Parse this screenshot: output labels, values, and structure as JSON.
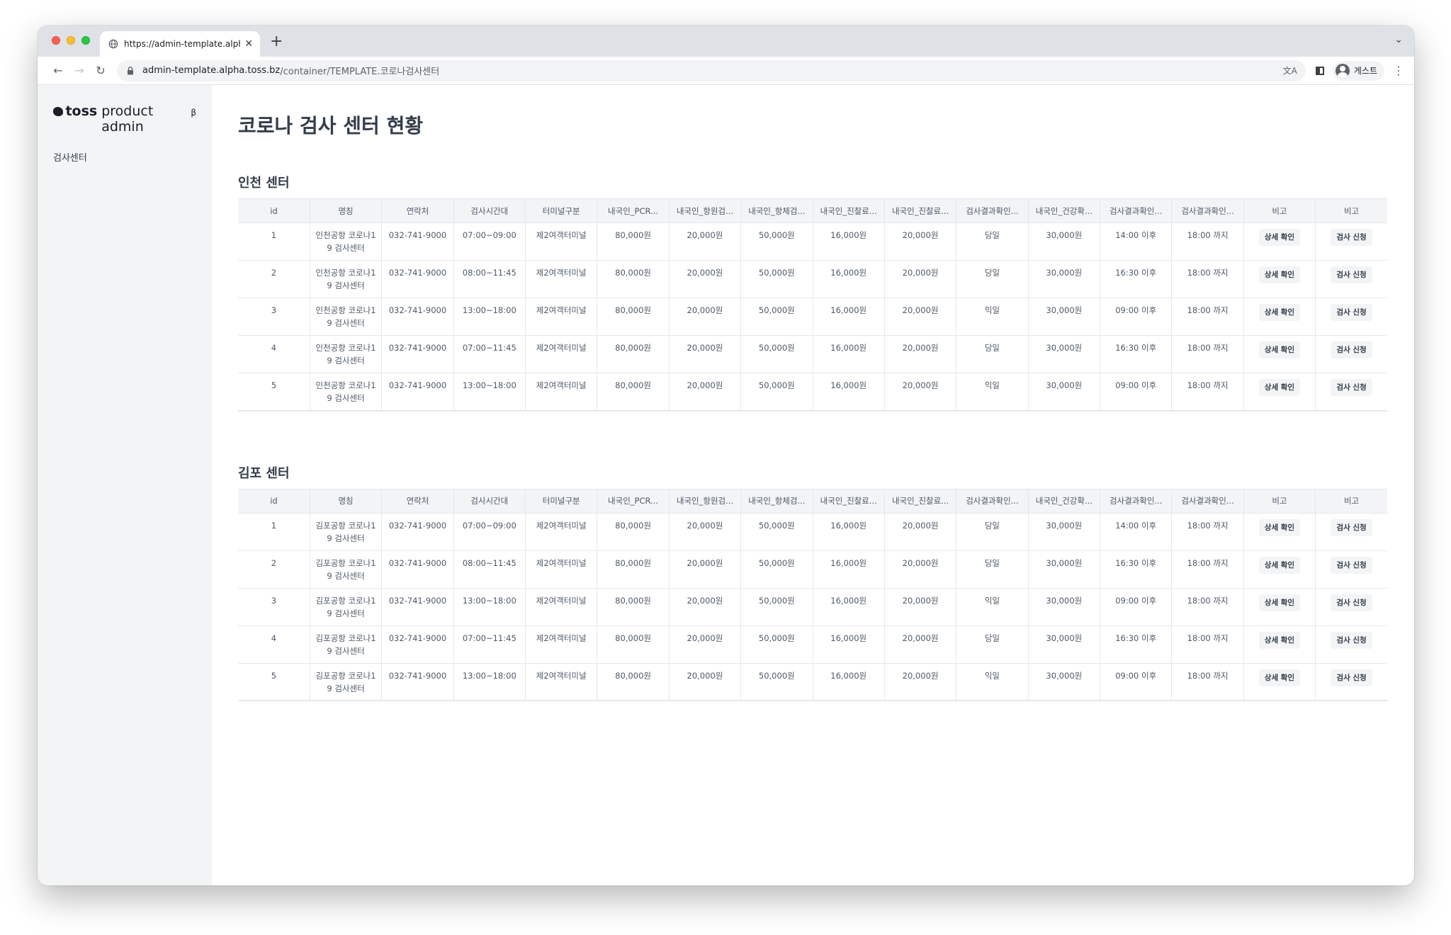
{
  "browser": {
    "tab_title": "https://admin-template.alpha.toss.bz",
    "url_host": "admin-template.alpha.toss.bz",
    "url_path": "/container/TEMPLATE.코로나검사센터",
    "profile_label": "게스트",
    "new_tab_symbol": "+",
    "tab_close_symbol": "✕"
  },
  "sidebar": {
    "logo_brand": "toss",
    "logo_suffix": "product admin",
    "logo_sup": "β",
    "items": [
      {
        "label": "검사센터"
      }
    ]
  },
  "page": {
    "title": "코로나 검사 센터 현황"
  },
  "columns": [
    "id",
    "명칭",
    "연락처",
    "검사시간대",
    "터미널구분",
    "내국인_PCR...",
    "내국인_항원검...",
    "내국인_항체검...",
    "내국인_진찰료...",
    "내국인_진찰료...",
    "검사결과확인...",
    "내국인_건강확...",
    "검사결과확인...",
    "검사결과확인...",
    "비고",
    "비고"
  ],
  "buttons": {
    "detail": "상세 확인",
    "apply": "검사 신청"
  },
  "sections": [
    {
      "title": "인천 센터",
      "rows": [
        [
          "1",
          "인천공항 코로나19 검사센터",
          "032-741-9000",
          "07:00~09:00",
          "제2여객터미널",
          "80,000원",
          "20,000원",
          "50,000원",
          "16,000원",
          "20,000원",
          "당일",
          "30,000원",
          "14:00 이후",
          "18:00 까지"
        ],
        [
          "2",
          "인천공항 코로나19 검사센터",
          "032-741-9000",
          "08:00~11:45",
          "제2여객터미널",
          "80,000원",
          "20,000원",
          "50,000원",
          "16,000원",
          "20,000원",
          "당일",
          "30,000원",
          "16:30 이후",
          "18:00 까지"
        ],
        [
          "3",
          "인천공항 코로나19 검사센터",
          "032-741-9000",
          "13:00~18:00",
          "제2여객터미널",
          "80,000원",
          "20,000원",
          "50,000원",
          "16,000원",
          "20,000원",
          "익일",
          "30,000원",
          "09:00 이후",
          "18:00 까지"
        ],
        [
          "4",
          "인천공항 코로나19 검사센터",
          "032-741-9000",
          "07:00~11:45",
          "제2여객터미널",
          "80,000원",
          "20,000원",
          "50,000원",
          "16,000원",
          "20,000원",
          "당일",
          "30,000원",
          "16:30 이후",
          "18:00 까지"
        ],
        [
          "5",
          "인천공항 코로나19 검사센터",
          "032-741-9000",
          "13:00~18:00",
          "제2여객터미널",
          "80,000원",
          "20,000원",
          "50,000원",
          "16,000원",
          "20,000원",
          "익일",
          "30,000원",
          "09:00 이후",
          "18:00 까지"
        ]
      ]
    },
    {
      "title": "김포 센터",
      "rows": [
        [
          "1",
          "김포공항 코로나19 검사센터",
          "032-741-9000",
          "07:00~09:00",
          "제2여객터미널",
          "80,000원",
          "20,000원",
          "50,000원",
          "16,000원",
          "20,000원",
          "당일",
          "30,000원",
          "14:00 이후",
          "18:00 까지"
        ],
        [
          "2",
          "김포공항 코로나19 검사센터",
          "032-741-9000",
          "08:00~11:45",
          "제2여객터미널",
          "80,000원",
          "20,000원",
          "50,000원",
          "16,000원",
          "20,000원",
          "당일",
          "30,000원",
          "16:30 이후",
          "18:00 까지"
        ],
        [
          "3",
          "김포공항 코로나19 검사센터",
          "032-741-9000",
          "13:00~18:00",
          "제2여객터미널",
          "80,000원",
          "20,000원",
          "50,000원",
          "16,000원",
          "20,000원",
          "익일",
          "30,000원",
          "09:00 이후",
          "18:00 까지"
        ],
        [
          "4",
          "김포공항 코로나19 검사센터",
          "032-741-9000",
          "07:00~11:45",
          "제2여객터미널",
          "80,000원",
          "20,000원",
          "50,000원",
          "16,000원",
          "20,000원",
          "당일",
          "30,000원",
          "16:30 이후",
          "18:00 까지"
        ],
        [
          "5",
          "김포공항 코로나19 검사센터",
          "032-741-9000",
          "13:00~18:00",
          "제2여객터미널",
          "80,000원",
          "20,000원",
          "50,000원",
          "16,000원",
          "20,000원",
          "익일",
          "30,000원",
          "09:00 이후",
          "18:00 까지"
        ]
      ]
    }
  ]
}
